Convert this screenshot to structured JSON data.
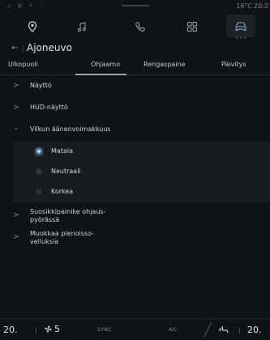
{
  "status": {
    "icons": "⊿ ◐ ▾ ◌",
    "temperature": "16°C",
    "time": "20:2"
  },
  "nav": {
    "items": [
      {
        "name": "navigation-icon",
        "active": false
      },
      {
        "name": "music-icon",
        "active": false
      },
      {
        "name": "phone-icon",
        "active": false
      },
      {
        "name": "apps-icon",
        "active": false
      },
      {
        "name": "car-icon",
        "active": true
      }
    ],
    "dots": "•••"
  },
  "header": {
    "back": "←",
    "title": "Ajoneuvo"
  },
  "tabs": [
    "Ulkopuoli",
    "Ohjaamo",
    "Rengaspaine",
    "Päivitys"
  ],
  "active_tab": "Ohjaamo",
  "list": {
    "items": [
      {
        "label": "Näyttö",
        "chevron": ">"
      },
      {
        "label": "HUD-näyttö",
        "chevron": ">"
      },
      {
        "label": "Vilkun äänenvoimakkuus",
        "chevron": "⌄"
      },
      {
        "label_line1": "Suosikkipainike ohjaus-",
        "label_line2": "pyörässä",
        "chevron": ">"
      },
      {
        "label_line1": "Muokkaa pienoisso-",
        "label_line2": "velluksia",
        "chevron": ">"
      }
    ],
    "options": [
      {
        "label": "Matala",
        "selected": true
      },
      {
        "label": "Neutraali",
        "selected": false
      },
      {
        "label": "Korkea",
        "selected": false
      }
    ]
  },
  "climate": {
    "left_temp": "20.",
    "fan_icon": "fan-icon",
    "fan_level": "5",
    "sync_label": "SYNC",
    "ac_label": "A/C",
    "seat_icon": "seat-heat-icon",
    "right_temp": "20."
  },
  "colors": {
    "background": "#101315",
    "accent": "#5a7a9a"
  }
}
